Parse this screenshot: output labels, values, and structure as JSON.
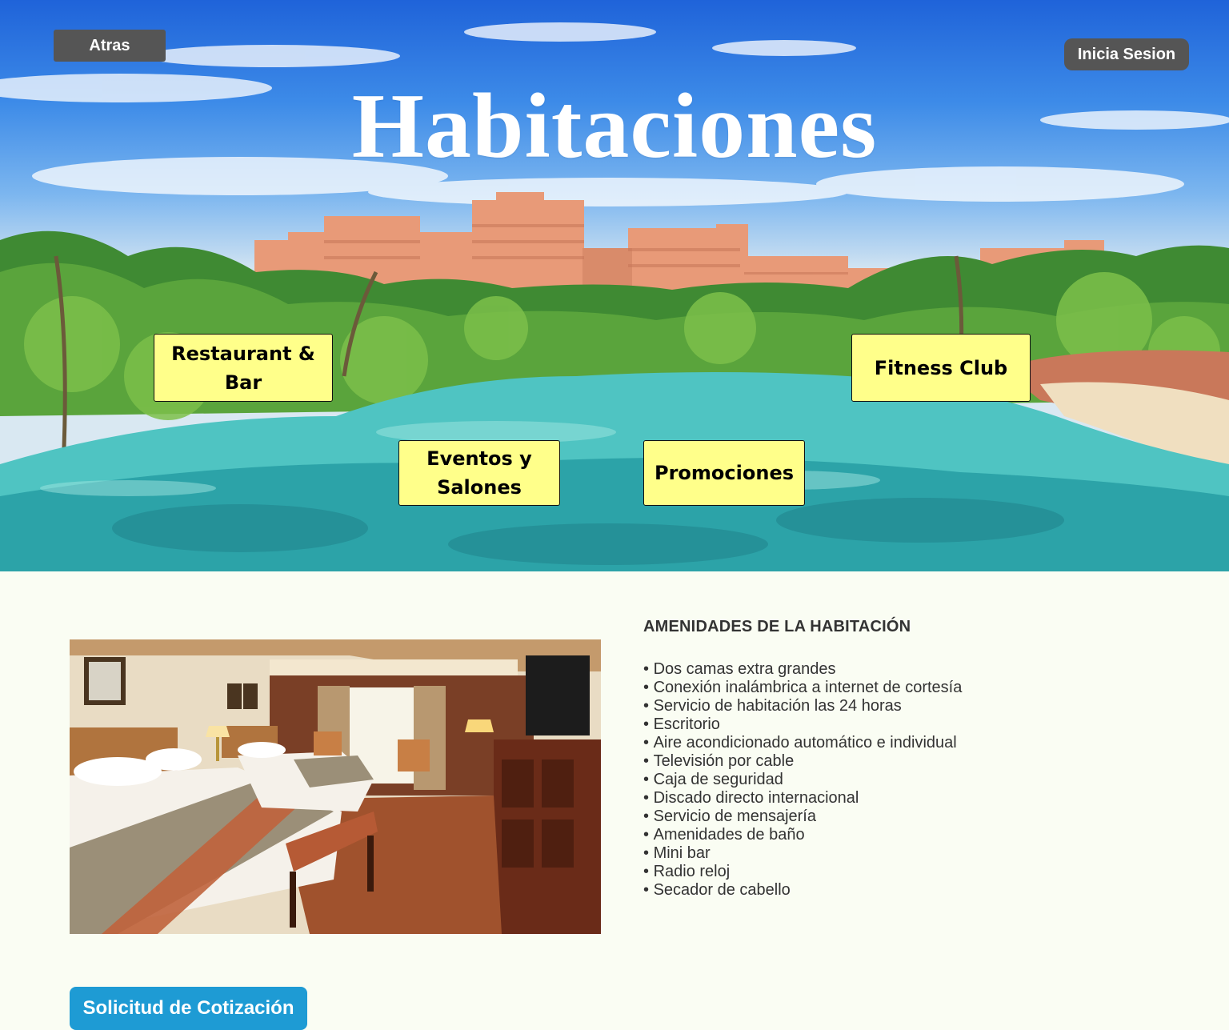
{
  "header": {
    "back_label": "Atras",
    "login_label": "Inicia Sesion",
    "title": "Habitaciones"
  },
  "nav": {
    "restaurant_label": "Restaurant & Bar",
    "fitness_label": "Fitness Club",
    "eventos_label": "Eventos y Salones",
    "promociones_label": "Promociones"
  },
  "amenities": {
    "heading": "AMENIDADES DE LA HABITACIÓN",
    "items": [
      "Dos camas extra grandes",
      "Conexión inalámbrica a internet de cortesía",
      "Servicio de habitación las 24 horas",
      "Escritorio",
      "Aire acondicionado automático e individual",
      "Televisión por cable",
      "Caja de seguridad",
      "Discado directo internacional",
      "Servicio de mensajería",
      "Amenidades de baño",
      "Mini bar",
      "Radio reloj",
      "Secador de cabello"
    ]
  },
  "cta": {
    "quote_label": "Solicitud de Cotización"
  },
  "colors": {
    "nav_box_bg": "#ffff8a",
    "dark_button_bg": "#555555",
    "quote_button_bg": "#1e9bd4",
    "page_bg": "#fafdf3"
  }
}
